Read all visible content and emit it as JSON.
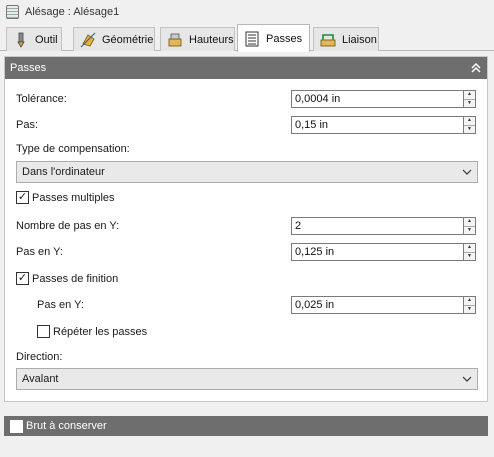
{
  "window": {
    "title": "Alésage : Alésage1",
    "icon": "bore-feature-icon"
  },
  "tabs": [
    {
      "label": "Outil",
      "icon": "tool-icon",
      "active": false
    },
    {
      "label": "Géométrie",
      "icon": "geometry-icon",
      "active": false
    },
    {
      "label": "Hauteurs",
      "icon": "heights-icon",
      "active": false
    },
    {
      "label": "Passes",
      "icon": "passes-icon",
      "active": true
    },
    {
      "label": "Liaison",
      "icon": "linking-icon",
      "active": false
    }
  ],
  "passes_section": {
    "title": "Passes",
    "collapse_icon": "double-chevron-up-icon",
    "tolerance": {
      "label": "Tolérance:",
      "value": "0,0004 in"
    },
    "pas": {
      "label": "Pas:",
      "value": "0,15 in"
    },
    "compensation": {
      "label": "Type de compensation:",
      "value": "Dans l'ordinateur"
    },
    "passes_multiples": {
      "label": "Passes multiples",
      "checked": true
    },
    "nombre_pas_y": {
      "label": "Nombre de pas en Y:",
      "value": "2"
    },
    "pas_y": {
      "label": "Pas en Y:",
      "value": "0,125 in"
    },
    "passes_finition": {
      "label": "Passes de finition",
      "checked": true
    },
    "finition_pas_y": {
      "label": "Pas en Y:",
      "value": "0,025 in"
    },
    "repeter_passes": {
      "label": "Répéter les passes",
      "checked": false
    },
    "direction": {
      "label": "Direction:",
      "value": "Avalant"
    }
  },
  "brut_section": {
    "label": "Brut à conserver",
    "checked": false
  }
}
